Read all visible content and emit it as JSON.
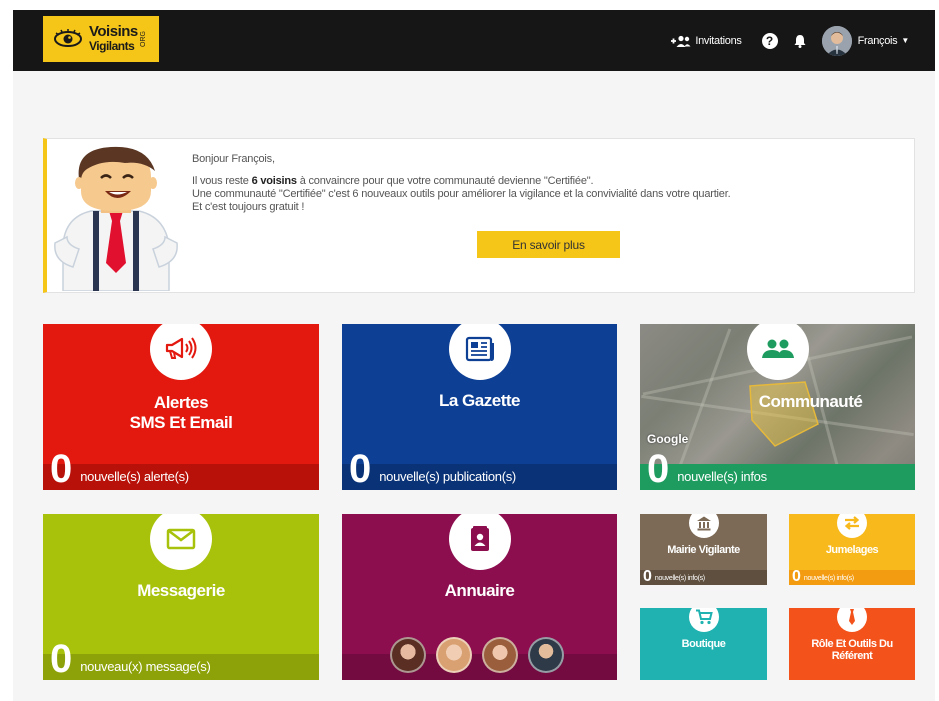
{
  "header": {
    "logo": {
      "line1": "Voisins",
      "line2": "Vigilants",
      "suffix": "ORG"
    },
    "invitations_label": "Invitations",
    "help_label": "?",
    "user_name": "François"
  },
  "banner": {
    "greeting": "Bonjour François,",
    "line1_pre": "Il vous reste ",
    "line1_bold": "6 voisins",
    "line1_post": " à convaincre pour que votre communauté devienne \"Certifiée\".",
    "line2": "Une communauté \"Certifiée\" c'est 6 nouveaux outils pour améliorer la vigilance et la convivialité dans votre quartier.",
    "line3": "Et c'est toujours gratuit !",
    "cta_label": "En savoir plus"
  },
  "tiles": {
    "alertes": {
      "title_line1": "Alertes",
      "title_line2": "SMS Et Email",
      "count": "0",
      "count_label": "nouvelle(s) alerte(s)",
      "color": "#e3180f"
    },
    "gazette": {
      "title": "La Gazette",
      "count": "0",
      "count_label": "nouvelle(s) publication(s)",
      "color": "#0d3f94"
    },
    "communaute": {
      "title": "Communauté",
      "count": "0",
      "count_label": "nouvelle(s) infos",
      "map_credit": "Google",
      "color": "#1e9b5e"
    },
    "messagerie": {
      "title": "Messagerie",
      "count": "0",
      "count_label": "nouveau(x) message(s)",
      "color": "#a8c10a"
    },
    "annuaire": {
      "title": "Annuaire",
      "color": "#8c0e4f"
    },
    "mairie": {
      "title": "Mairie Vigilante",
      "count": "0",
      "count_label": "nouvelle(s) info(s)",
      "color": "#7c6a56"
    },
    "jumelages": {
      "title": "Jumelages",
      "count": "0",
      "count_label": "nouvelle(s) info(s)",
      "color": "#f7b91b"
    },
    "boutique": {
      "title": "Boutique",
      "color": "#1fb2b0"
    },
    "referent": {
      "title_line1": "Rôle Et Outils Du",
      "title_line2": "Référent",
      "color": "#f3531b"
    }
  },
  "icons": {
    "invitations": "add-users-icon",
    "help": "help-icon",
    "notifications": "bell-icon",
    "alertes": "megaphone-icon",
    "gazette": "newspaper-icon",
    "communaute": "group-icon",
    "messagerie": "envelope-icon",
    "annuaire": "contact-card-icon",
    "mairie": "town-hall-icon",
    "jumelages": "swap-arrows-icon",
    "boutique": "cart-icon",
    "referent": "tie-icon"
  }
}
